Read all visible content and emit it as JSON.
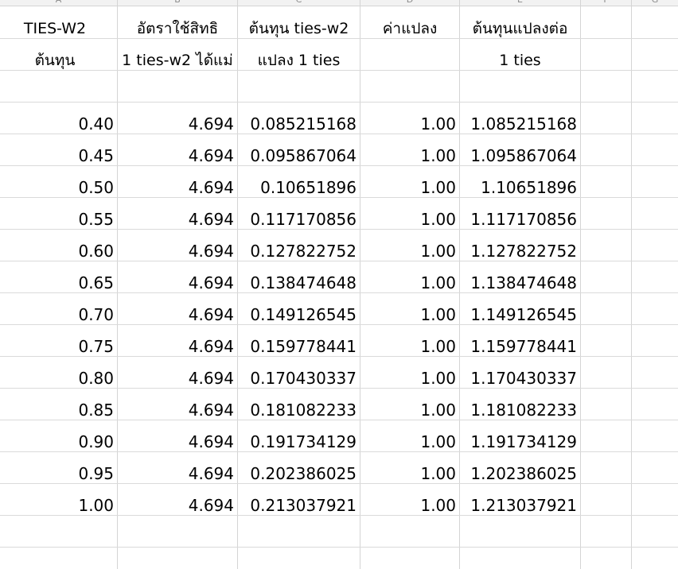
{
  "columns": [
    "A",
    "B",
    "C",
    "D",
    "E",
    "F",
    "G"
  ],
  "header_row_1": [
    "TIES-W2",
    "อัตราใช้สิทธิ",
    "ต้นทุน ties-w2",
    "ค่าแปลง",
    "ต้นทุนแปลงต่อ"
  ],
  "header_row_2": [
    "ต้นทุน",
    "1 ties-w2 ได้แม่",
    "แปลง 1 ties",
    "",
    "1 ties"
  ],
  "rows": [
    [
      "0.40",
      "4.694",
      "0.085215168",
      "1.00",
      "1.085215168"
    ],
    [
      "0.45",
      "4.694",
      "0.095867064",
      "1.00",
      "1.095867064"
    ],
    [
      "0.50",
      "4.694",
      "0.10651896",
      "1.00",
      "1.10651896"
    ],
    [
      "0.55",
      "4.694",
      "0.117170856",
      "1.00",
      "1.117170856"
    ],
    [
      "0.60",
      "4.694",
      "0.127822752",
      "1.00",
      "1.127822752"
    ],
    [
      "0.65",
      "4.694",
      "0.138474648",
      "1.00",
      "1.138474648"
    ],
    [
      "0.70",
      "4.694",
      "0.149126545",
      "1.00",
      "1.149126545"
    ],
    [
      "0.75",
      "4.694",
      "0.159778441",
      "1.00",
      "1.159778441"
    ],
    [
      "0.80",
      "4.694",
      "0.170430337",
      "1.00",
      "1.170430337"
    ],
    [
      "0.85",
      "4.694",
      "0.181082233",
      "1.00",
      "1.181082233"
    ],
    [
      "0.90",
      "4.694",
      "0.191734129",
      "1.00",
      "1.191734129"
    ],
    [
      "0.95",
      "4.694",
      "0.202386025",
      "1.00",
      "1.202386025"
    ],
    [
      "1.00",
      "4.694",
      "0.213037921",
      "1.00",
      "1.213037921"
    ]
  ]
}
